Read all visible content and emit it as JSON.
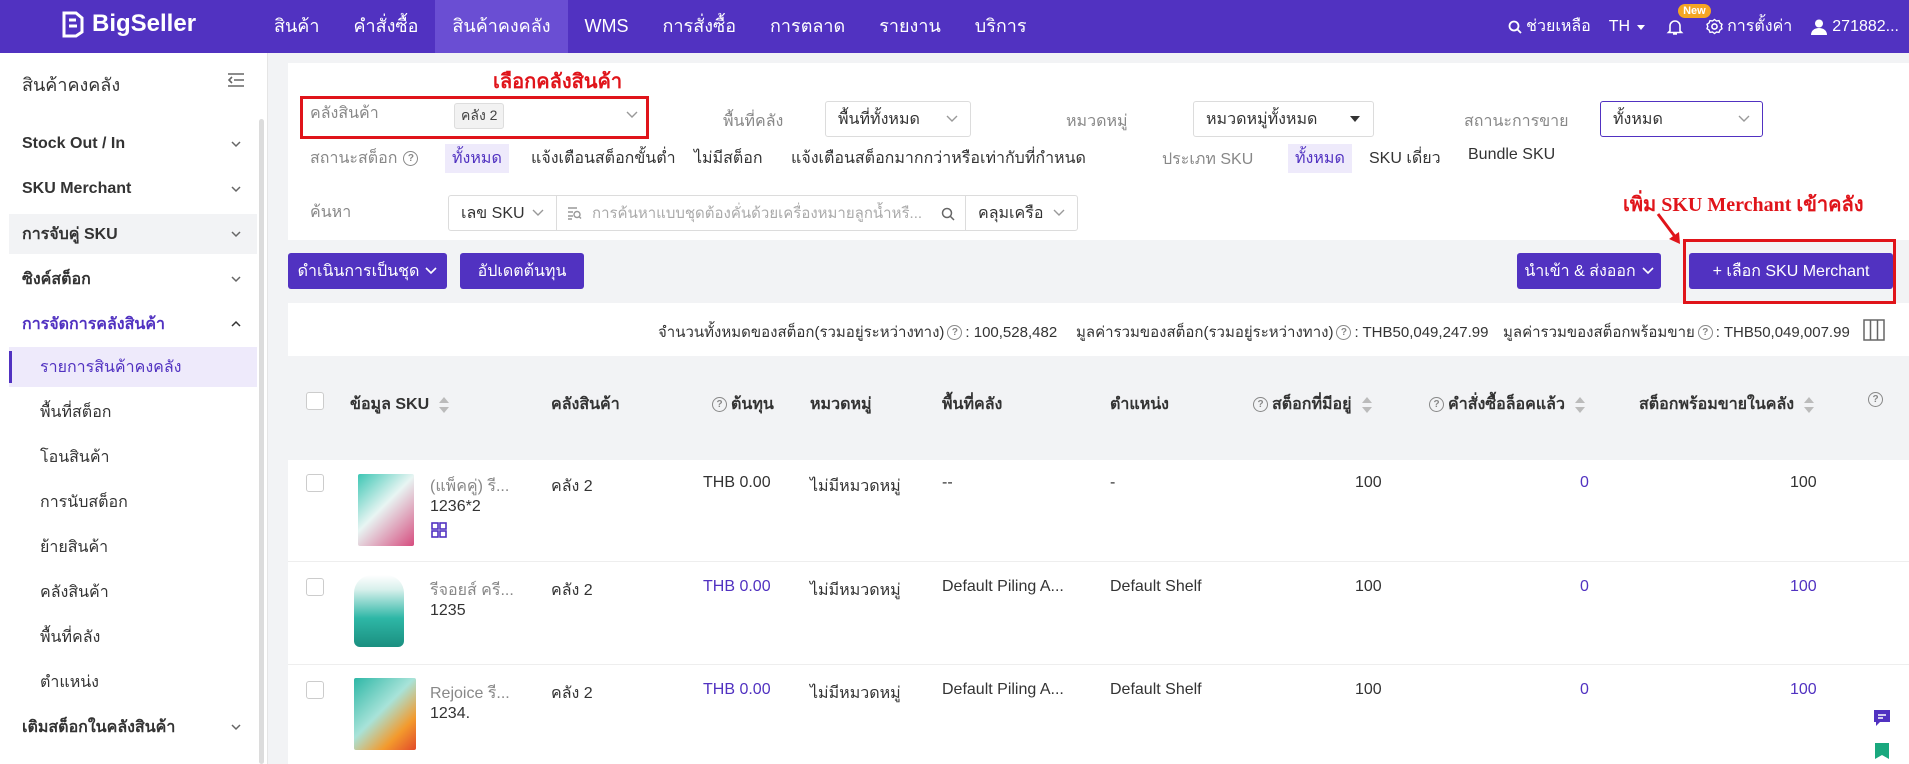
{
  "brand": {
    "name": "BigSeller"
  },
  "topnav": {
    "items": [
      "สินค้า",
      "คำสั่งซื้อ",
      "สินค้าคงคลัง",
      "WMS",
      "การสั่งซื้อ",
      "การตลาด",
      "รายงาน",
      "บริการ"
    ],
    "active_index": 2,
    "help": "ช่วยเหลือ",
    "lang": "TH",
    "new_badge": "New",
    "settings": "การตั้งค่า",
    "user": "271882..."
  },
  "sidebar": {
    "title": "สินค้าคงคลัง",
    "groups": [
      "Stock Out / In",
      "SKU Merchant",
      "การจับคู่ SKU",
      "ซิงค์สต็อก",
      "การจัดการคลังสินค้า"
    ],
    "subitems": [
      "รายการสินค้าคงคลัง",
      "พื้นที่สต็อก",
      "โอนสินค้า",
      "การนับสต็อก",
      "ย้ายสินค้า",
      "คลังสินค้า",
      "พื้นที่คลัง",
      "ตำแหน่ง"
    ],
    "last_group": "เติมสต็อกในคลังสินค้า"
  },
  "annotations": {
    "warehouse": "เลือกคลังสินค้า",
    "add_sku": "เพิ่ม SKU Merchant เข้าคลัง"
  },
  "filters": {
    "warehouse_label": "คลังสินค้า",
    "warehouse_value": "คลัง 2",
    "area_label": "พื้นที่คลัง",
    "area_value": "พื้นที่ทั้งหมด",
    "category_label": "หมวดหมู่",
    "category_value": "หมวดหมู่ทั้งหมด",
    "sale_status_label": "สถานะการขาย",
    "sale_status_value": "ทั้งหมด",
    "stock_status_label": "สถานะสต็อก",
    "stock_status_options": [
      "ทั้งหมด",
      "แจ้งเตือนสต็อกขั้นต่ำ",
      "ไม่มีสต็อก",
      "แจ้งเตือนสต็อกมากกว่าหรือเท่ากับที่กำหนด"
    ],
    "sku_type_label": "ประเภท SKU",
    "sku_type_options": [
      "ทั้งหมด",
      "SKU เดี่ยว",
      "Bundle SKU"
    ],
    "search_label": "ค้นหา",
    "search_type": "เลข SKU",
    "search_placeholder": "การค้นหาแบบชุดต้องคั่นด้วยเครื่องหมายลูกน้ำหรื...",
    "match_mode": "คลุมเครือ"
  },
  "toolbar": {
    "bulk_action": "ดำเนินการเป็นชุด",
    "update_cost": "อัปเดตต้นทุน",
    "import_export": "นำเข้า & ส่งออก",
    "add_sku": "+ เลือก SKU Merchant"
  },
  "summary": {
    "total_stock_label": "จำนวนทั้งหมดของสต็อก(รวมอยู่ระหว่างทาง)",
    "total_stock": ": 100,528,482",
    "total_value_label": "มูลค่ารวมของสต็อก(รวมอยู่ระหว่างทาง)",
    "total_value": ": THB50,049,247.99",
    "available_value_label": "มูลค่ารวมของสต็อกพร้อมขาย",
    "available_value": ": THB50,049,007.99"
  },
  "table": {
    "headers": [
      "ข้อมูล SKU",
      "คลังสินค้า",
      "ต้นทุน",
      "หมวดหมู่",
      "พื้นที่คลัง",
      "ตำแหน่ง",
      "สต็อกที่มีอยู่",
      "คำสั่งซื้อล็อคแล้ว",
      "สต็อกพร้อมขายในคลัง"
    ],
    "rows": [
      {
        "name": "(แพ็คคู่) รี...",
        "sku": "1236*2",
        "warehouse": "คลัง 2",
        "cost": "THB 0.00",
        "category": "ไม่มีหมวดหมู่",
        "area": "--",
        "location": "-",
        "stock": "100",
        "locked": "0",
        "available": "100"
      },
      {
        "name": "รีจอยส์ ครี...",
        "sku": "1235",
        "warehouse": "คลัง 2",
        "cost": "THB 0.00",
        "category": "ไม่มีหมวดหมู่",
        "area": "Default Piling A...",
        "location": "Default Shelf",
        "stock": "100",
        "locked": "0",
        "available": "100"
      },
      {
        "name": "Rejoice รี...",
        "sku": "1234.",
        "warehouse": "คลัง 2",
        "cost": "THB 0.00",
        "category": "ไม่มีหมวดหมู่",
        "area": "Default Piling A...",
        "location": "Default Shelf",
        "stock": "100",
        "locked": "0",
        "available": "100"
      }
    ]
  },
  "colors": {
    "brand": "#5132c1",
    "annotation": "#e0141a"
  }
}
